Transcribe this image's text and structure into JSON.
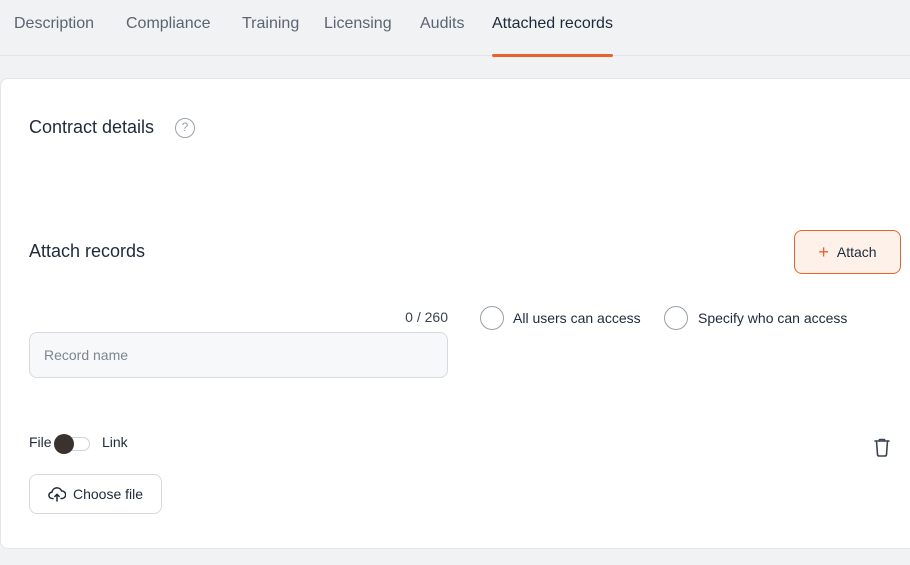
{
  "tabs": [
    {
      "label": "Description"
    },
    {
      "label": "Compliance"
    },
    {
      "label": "Training"
    },
    {
      "label": "Licensing"
    },
    {
      "label": "Audits"
    },
    {
      "label": "Attached records",
      "active": true
    }
  ],
  "contract_details": {
    "title": "Contract details",
    "help_icon": "question-circle-icon",
    "help_glyph": "?"
  },
  "attach_records": {
    "title": "Attach records",
    "attach_button": {
      "icon": "plus-icon",
      "plus": "+",
      "label": "Attach"
    },
    "counter": "0 / 260",
    "record_name_placeholder": "Record name",
    "record_name_value": "",
    "access_options": [
      {
        "label": "All users can access",
        "selected": false
      },
      {
        "label": "Specify who can access",
        "selected": false
      }
    ],
    "toggle": {
      "left_label": "File",
      "right_label": "Link",
      "state": "File"
    },
    "delete_icon": "trash-icon",
    "choose_file": {
      "icon": "upload-cloud-icon",
      "label": "Choose file"
    }
  },
  "colors": {
    "accent": "#e8622a",
    "accent_bg": "#fdf1ea",
    "text": "#1f2a3a",
    "muted": "#5b6472"
  }
}
